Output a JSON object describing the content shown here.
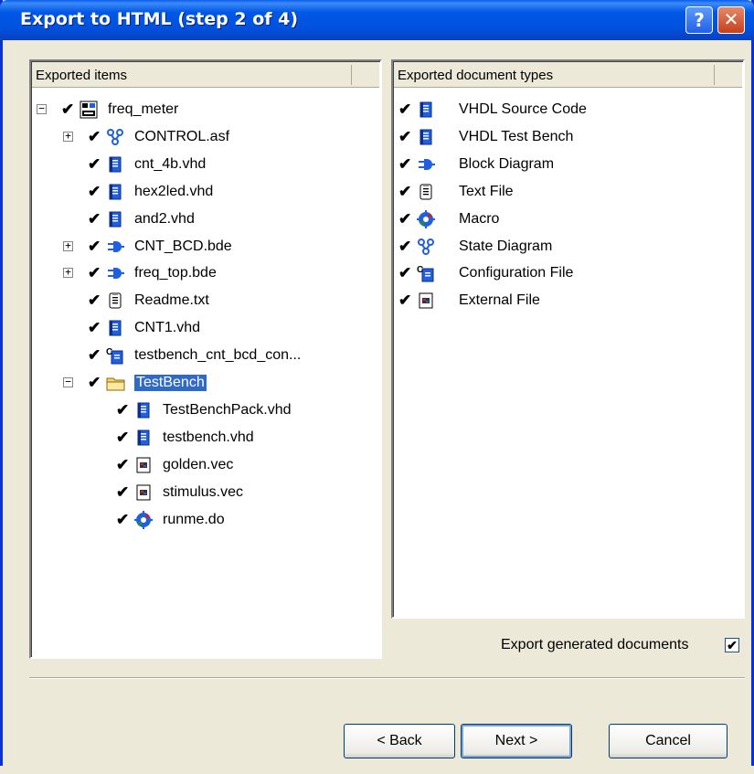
{
  "window": {
    "title": "Export to HTML (step 2 of 4)",
    "help_button": "?",
    "close_button": "✕"
  },
  "left_panel": {
    "header": "Exported items",
    "items": [
      {
        "label": "freq_meter",
        "icon": "design-icon",
        "expander": "−",
        "level": 0
      },
      {
        "label": "CONTROL.asf",
        "icon": "state-diagram-icon",
        "expander": "+",
        "level": 1
      },
      {
        "label": "cnt_4b.vhd",
        "icon": "vhdl-file-icon",
        "expander": "",
        "level": 1
      },
      {
        "label": "hex2led.vhd",
        "icon": "vhdl-file-icon",
        "expander": "",
        "level": 1
      },
      {
        "label": "and2.vhd",
        "icon": "vhdl-file-icon",
        "expander": "",
        "level": 1
      },
      {
        "label": "CNT_BCD.bde",
        "icon": "block-diagram-icon",
        "expander": "+",
        "level": 1
      },
      {
        "label": "freq_top.bde",
        "icon": "block-diagram-icon",
        "expander": "+",
        "level": 1
      },
      {
        "label": "Readme.txt",
        "icon": "text-file-icon",
        "expander": "",
        "level": 1
      },
      {
        "label": "CNT1.vhd",
        "icon": "vhdl-file-icon",
        "expander": "",
        "level": 1
      },
      {
        "label": "testbench_cnt_bcd_con...",
        "icon": "configuration-file-icon",
        "expander": "",
        "level": 1
      },
      {
        "label": "TestBench",
        "icon": "folder-icon",
        "expander": "−",
        "level": 1,
        "selected": true
      },
      {
        "label": "TestBenchPack.vhd",
        "icon": "vhdl-file-icon",
        "expander": "",
        "level": 2
      },
      {
        "label": "testbench.vhd",
        "icon": "vhdl-file-icon",
        "expander": "",
        "level": 2
      },
      {
        "label": "golden.vec",
        "icon": "external-file-icon",
        "expander": "",
        "level": 2
      },
      {
        "label": "stimulus.vec",
        "icon": "external-file-icon",
        "expander": "",
        "level": 2
      },
      {
        "label": "runme.do",
        "icon": "macro-icon",
        "expander": "",
        "level": 2
      }
    ]
  },
  "right_panel": {
    "header": "Exported document types",
    "items": [
      {
        "label": "VHDL Source Code",
        "icon": "vhdl-file-icon"
      },
      {
        "label": "VHDL Test Bench",
        "icon": "vhdl-file-icon"
      },
      {
        "label": "Block Diagram",
        "icon": "block-diagram-icon"
      },
      {
        "label": "Text File",
        "icon": "text-file-icon"
      },
      {
        "label": "Macro",
        "icon": "macro-icon"
      },
      {
        "label": "State Diagram",
        "icon": "state-diagram-icon"
      },
      {
        "label": "Configuration File",
        "icon": "configuration-file-icon"
      },
      {
        "label": "External File",
        "icon": "external-file-icon"
      }
    ]
  },
  "export_generated": {
    "label": "Export generated documents",
    "checked": true
  },
  "buttons": {
    "back": "< Back",
    "next": "Next >",
    "cancel": "Cancel"
  },
  "colors": {
    "title_bar": "#0058E6",
    "dialog_bg": "#ECE9D8",
    "selection": "#316AC5",
    "icon_blue": "#1F5FE0"
  }
}
